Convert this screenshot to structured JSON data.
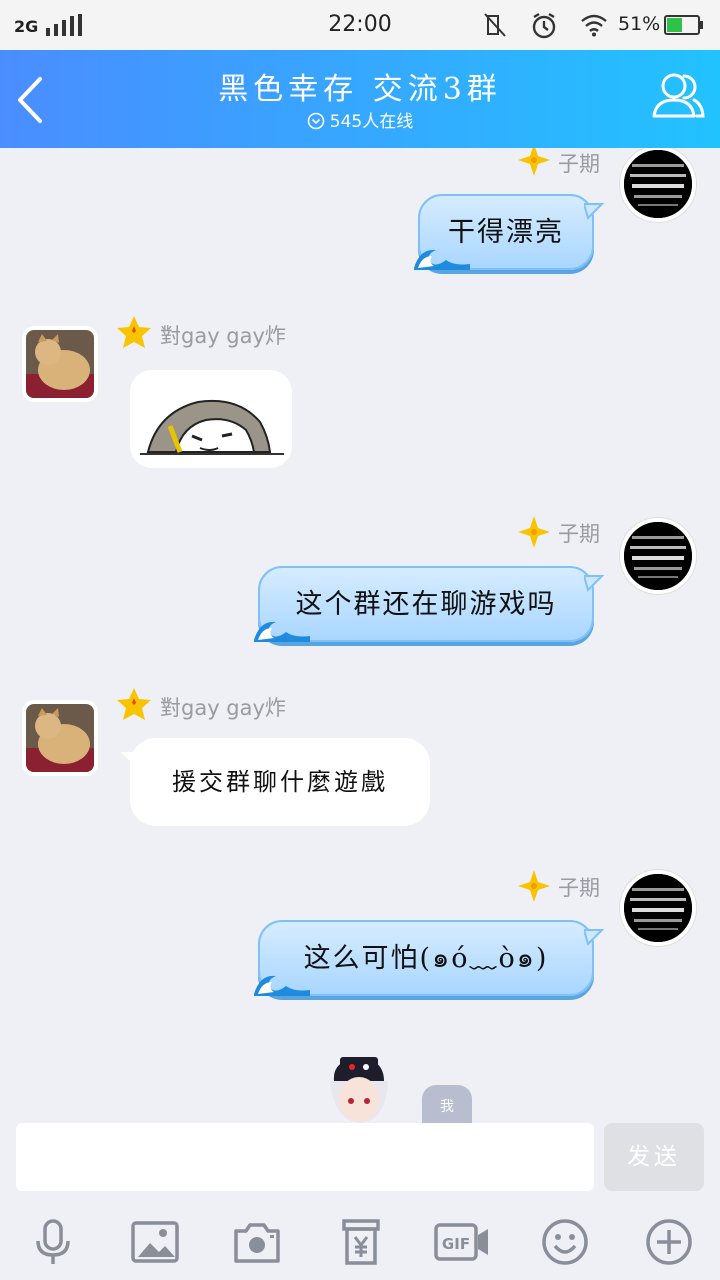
{
  "status_bar": {
    "network": "2G",
    "time": "22:00",
    "battery_percent": "51%",
    "battery_level": 0.51,
    "icons": [
      "signal-icon",
      "mute-icon",
      "alarm-icon",
      "wifi-icon",
      "battery-icon"
    ]
  },
  "header": {
    "title": "黑色幸存 交流3群",
    "online_count": "545人在线",
    "back_icon": "chevron-left-icon",
    "members_icon": "group-icon",
    "gradient": [
      "#4a8dff",
      "#22c2ff"
    ]
  },
  "messages": [
    {
      "side": "right",
      "sender": "子期",
      "text": "干得漂亮",
      "partial": true
    },
    {
      "side": "left",
      "sender": "對gay gay炸",
      "type": "sticker"
    },
    {
      "side": "right",
      "sender": "子期",
      "text": "这个群还在聊游戏吗"
    },
    {
      "side": "left",
      "sender": "對gay gay炸",
      "text": "援交群聊什麼遊戲"
    },
    {
      "side": "right",
      "sender": "子期",
      "text": "这么可怕(๑ó﹏ò๑)"
    }
  ],
  "self_tag": "我",
  "composer": {
    "input_value": "",
    "send_label": "发送"
  },
  "toolbar": {
    "items": [
      "microphone-icon",
      "image-icon",
      "camera-icon",
      "red-packet-icon",
      "gif-icon",
      "emoji-icon",
      "add-icon"
    ]
  },
  "colors": {
    "accent": "#2aa8ff",
    "chat_bg": "#eef0f6",
    "bubble_right": "#b9ddff",
    "bubble_left": "#ffffff",
    "send_disabled": "#dfe0e4"
  }
}
